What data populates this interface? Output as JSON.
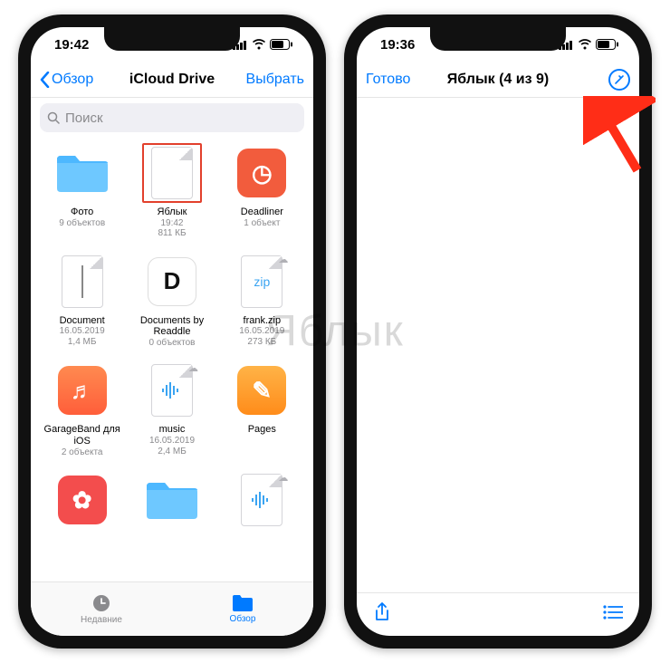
{
  "colors": {
    "accent": "#007aff",
    "highlight": "#e2402c"
  },
  "watermark": "Яблык",
  "left": {
    "status": {
      "time": "19:42"
    },
    "nav": {
      "back": "Обзор",
      "title": "iCloud Drive",
      "select": "Выбрать"
    },
    "search_placeholder": "Поиск",
    "items": [
      {
        "kind": "folder",
        "name": "Фото",
        "line1": "9 объектов",
        "line2": ""
      },
      {
        "kind": "doc-blank",
        "name": "Яблык",
        "line1": "19:42",
        "line2": "811 КБ",
        "highlighted": true
      },
      {
        "kind": "app",
        "name": "Deadliner",
        "line1": "1 объект",
        "line2": "",
        "bg": "#f25c3d",
        "glyph": "◷"
      },
      {
        "kind": "doc-line",
        "name": "Document",
        "line1": "16.05.2019",
        "line2": "1,4 МБ"
      },
      {
        "kind": "app",
        "name": "Documents by Readdle",
        "line1": "0 объектов",
        "line2": "",
        "bg": "#ffffff",
        "glyph": "D",
        "fg": "#111",
        "border": true
      },
      {
        "kind": "doc-zip",
        "name": "frank.zip",
        "line1": "16.05.2019",
        "line2": "273 КБ",
        "cloud": true,
        "label": "zip"
      },
      {
        "kind": "app",
        "name": "GarageBand для iOS",
        "line1": "2 объекта",
        "line2": "",
        "bg": "linear-gradient(#ff8a50,#ff5e3a)",
        "glyph": "♬"
      },
      {
        "kind": "doc-audio",
        "name": "music",
        "line1": "16.05.2019",
        "line2": "2,4 МБ",
        "cloud": true
      },
      {
        "kind": "app",
        "name": "Pages",
        "line1": "",
        "line2": "",
        "bg": "linear-gradient(#ffb347,#ff8c1a)",
        "glyph": "✎"
      },
      {
        "kind": "app",
        "name": "",
        "line1": "",
        "line2": "",
        "bg": "#f34d4d",
        "glyph": "✿"
      },
      {
        "kind": "folder",
        "name": "",
        "line1": "",
        "line2": ""
      },
      {
        "kind": "doc-audio",
        "name": "",
        "line1": "",
        "line2": "",
        "cloud": true
      }
    ],
    "tabs": {
      "recent": "Недавние",
      "browse": "Обзор"
    }
  },
  "right": {
    "status": {
      "time": "19:36"
    },
    "nav": {
      "done": "Готово",
      "title": "Яблык (4 из 9)",
      "markup_icon": "markup-icon"
    },
    "toolbar": {
      "share_icon": "share-icon",
      "list_icon": "list-icon"
    }
  }
}
